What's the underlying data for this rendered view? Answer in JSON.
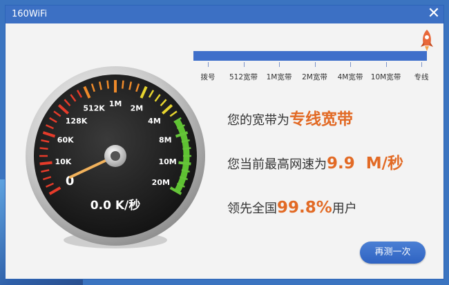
{
  "window": {
    "title": "160WiFi",
    "close_symbol": "✕"
  },
  "scale_labels": [
    "拨号",
    "512宽带",
    "1M宽带",
    "2M宽带",
    "4M宽带",
    "10M宽带",
    "专线"
  ],
  "gauge": {
    "labels": [
      "0",
      "10K",
      "60K",
      "128K",
      "512K",
      "1M",
      "2M",
      "4M",
      "8M",
      "10M",
      "20M"
    ],
    "speed_text": "0.0 K/秒",
    "needle_level": 0.6
  },
  "result": {
    "line1_prefix": "您的宽带为",
    "line1_value": "专线宽带",
    "line2_prefix": "您当前最高网速为",
    "line2_value": "9.9  M/秒",
    "line3_prefix": "领先全国",
    "line3_value": "99.8%",
    "line3_suffix": "用户"
  },
  "buttons": {
    "retest": "再测一次"
  },
  "colors": {
    "accent": "#e26a25",
    "scale": "#3f6fca",
    "title_bar": "#3c70c4"
  }
}
